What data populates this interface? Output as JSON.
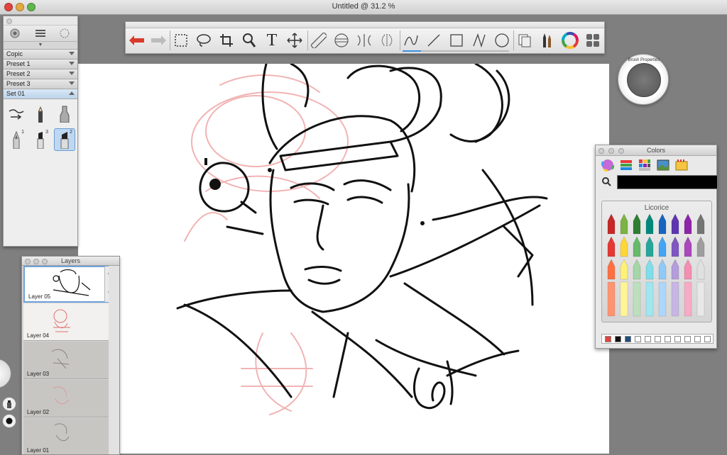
{
  "window": {
    "title": "Untitled @ 31.2 %"
  },
  "toolbar": {
    "tools": [
      "undo-icon",
      "redo-icon",
      "rectangle-select-icon",
      "lasso-icon",
      "crop-icon",
      "magnifier-icon",
      "text-icon",
      "transform-icon",
      "ruler-icon",
      "ellipse-guide-icon",
      "symmetry-icon",
      "mirror-icon",
      "stroke-icon",
      "line-icon",
      "rectangle-icon",
      "polyline-icon",
      "ellipse-icon",
      "layers-copy-icon",
      "brushes-icon",
      "color-wheel-icon",
      "panels-icon"
    ],
    "text_tool_glyph": "T"
  },
  "brush_panel": {
    "presets": [
      "Copic",
      "Preset 1",
      "Preset 2",
      "Preset 3",
      "Set 01"
    ],
    "active_preset": "Set 01",
    "brush_numbers": [
      "1",
      "3",
      "2"
    ]
  },
  "layers": {
    "title": "Layers",
    "items": [
      "Layer 05",
      "Layer 04",
      "Layer 03",
      "Layer 02",
      "Layer 01"
    ],
    "selected": "Layer 05"
  },
  "brush_properties": {
    "label": "Brush Properties"
  },
  "colors": {
    "title": "Colors",
    "crayon_set_name": "Licorice",
    "current_color": "#000000",
    "favorites": [
      "#e0443e",
      "#111111",
      "#1d4f7a"
    ]
  }
}
